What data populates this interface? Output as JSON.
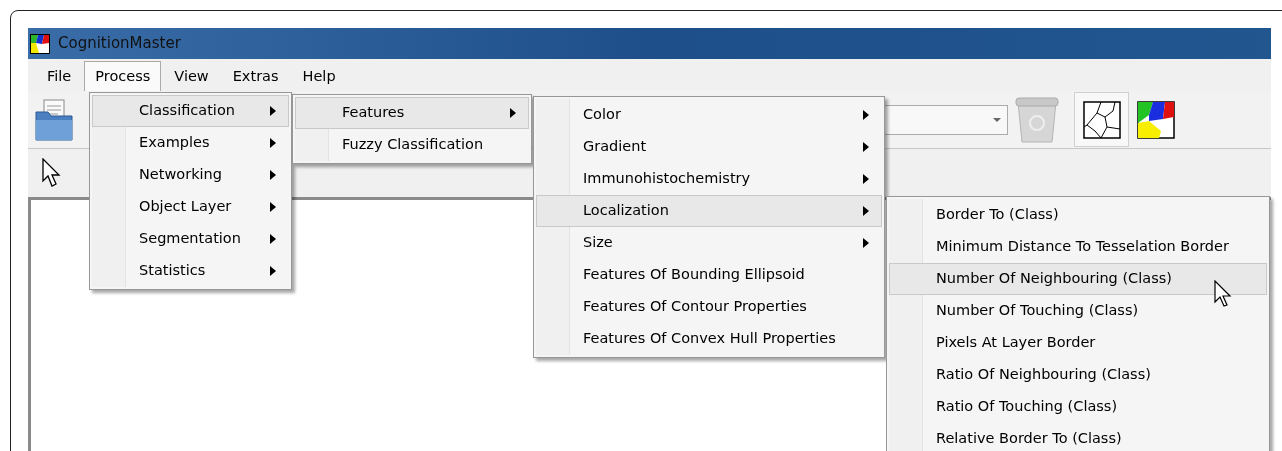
{
  "window": {
    "title": "CognitionMaster"
  },
  "menubar": [
    {
      "label": "File",
      "selected": false
    },
    {
      "label": "Process",
      "selected": true
    },
    {
      "label": "View",
      "selected": false
    },
    {
      "label": "Extras",
      "selected": false
    },
    {
      "label": "Help",
      "selected": false
    }
  ],
  "menus": [
    {
      "items": [
        {
          "label": "Classification",
          "submenu": true,
          "selected": true
        },
        {
          "label": "Examples",
          "submenu": true,
          "selected": false
        },
        {
          "label": "Networking",
          "submenu": true,
          "selected": false
        },
        {
          "label": "Object Layer",
          "submenu": true,
          "selected": false
        },
        {
          "label": "Segmentation",
          "submenu": true,
          "selected": false
        },
        {
          "label": "Statistics",
          "submenu": true,
          "selected": false
        }
      ]
    },
    {
      "items": [
        {
          "label": "Features",
          "submenu": true,
          "selected": true
        },
        {
          "label": "Fuzzy Classification",
          "submenu": false,
          "selected": false
        }
      ]
    },
    {
      "items": [
        {
          "label": "Color",
          "submenu": true,
          "selected": false
        },
        {
          "label": "Gradient",
          "submenu": true,
          "selected": false
        },
        {
          "label": "Immunohistochemistry",
          "submenu": true,
          "selected": false
        },
        {
          "label": "Localization",
          "submenu": true,
          "selected": true
        },
        {
          "label": "Size",
          "submenu": true,
          "selected": false
        },
        {
          "label": "Features Of Bounding Ellipsoid",
          "submenu": false,
          "selected": false
        },
        {
          "label": "Features Of Contour Properties",
          "submenu": false,
          "selected": false
        },
        {
          "label": "Features Of Convex Hull Properties",
          "submenu": false,
          "selected": false
        }
      ]
    },
    {
      "items": [
        {
          "label": "Border To (Class)",
          "submenu": false,
          "selected": false
        },
        {
          "label": "Minimum Distance To Tesselation Border",
          "submenu": false,
          "selected": false
        },
        {
          "label": "Number Of Neighbouring (Class)",
          "submenu": false,
          "selected": true
        },
        {
          "label": "Number Of Touching (Class)",
          "submenu": false,
          "selected": false
        },
        {
          "label": "Pixels At Layer Border",
          "submenu": false,
          "selected": false
        },
        {
          "label": "Ratio Of Neighbouring (Class)",
          "submenu": false,
          "selected": false
        },
        {
          "label": "Ratio Of Touching (Class)",
          "submenu": false,
          "selected": false
        },
        {
          "label": "Relative Border To (Class)",
          "submenu": false,
          "selected": false
        }
      ]
    }
  ]
}
